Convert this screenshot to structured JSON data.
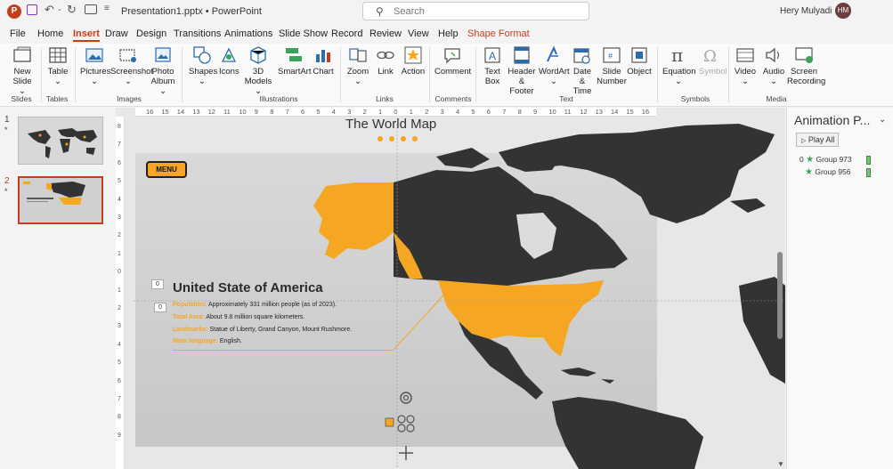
{
  "titlebar": {
    "filename": "Presentation1.pptx  •  PowerPoint",
    "search_placeholder": "Search",
    "user_name": "Hery Mulyadi",
    "avatar_initials": "HM"
  },
  "tabs": [
    "File",
    "Home",
    "Insert",
    "Draw",
    "Design",
    "Transitions",
    "Animations",
    "Slide Show",
    "Record",
    "Review",
    "View",
    "Help",
    "Shape Format"
  ],
  "active_tab": "Insert",
  "ribbon": {
    "buttons": [
      {
        "label": "New\nSlide ⌄",
        "icon": "new-slide-icon"
      },
      {
        "label": "Table\n⌄",
        "icon": "table-icon"
      },
      {
        "label": "Pictures\n⌄",
        "icon": "pictures-icon"
      },
      {
        "label": "Screenshot\n⌄",
        "icon": "screenshot-icon"
      },
      {
        "label": "Photo\nAlbum ⌄",
        "icon": "photo-album-icon"
      },
      {
        "label": "Shapes\n⌄",
        "icon": "shapes-icon"
      },
      {
        "label": "Icons",
        "icon": "icons-icon"
      },
      {
        "label": "3D\nModels ⌄",
        "icon": "3d-models-icon"
      },
      {
        "label": "SmartArt",
        "icon": "smartart-icon"
      },
      {
        "label": "Chart",
        "icon": "chart-icon"
      },
      {
        "label": "Zoom\n⌄",
        "icon": "zoom-icon"
      },
      {
        "label": "Link",
        "icon": "link-icon"
      },
      {
        "label": "Action",
        "icon": "action-icon"
      },
      {
        "label": "Comment",
        "icon": "comment-icon"
      },
      {
        "label": "Text\nBox",
        "icon": "text-box-icon"
      },
      {
        "label": "Header\n& Footer",
        "icon": "header-footer-icon"
      },
      {
        "label": "WordArt\n⌄",
        "icon": "wordart-icon"
      },
      {
        "label": "Date &\nTime",
        "icon": "date-time-icon"
      },
      {
        "label": "Slide\nNumber",
        "icon": "slide-number-icon"
      },
      {
        "label": "Object",
        "icon": "object-icon"
      },
      {
        "label": "Equation\n⌄",
        "icon": "equation-icon"
      },
      {
        "label": "Symbol",
        "icon": "symbol-icon"
      },
      {
        "label": "Video\n⌄",
        "icon": "video-icon"
      },
      {
        "label": "Audio\n⌄",
        "icon": "audio-icon"
      },
      {
        "label": "Screen\nRecording",
        "icon": "screen-recording-icon"
      }
    ],
    "groups": [
      "Slides",
      "Tables",
      "Images",
      "Illustrations",
      "Links",
      "Comments",
      "Text",
      "Symbols",
      "Media"
    ]
  },
  "thumbnails": [
    {
      "number": "1",
      "star": "*"
    },
    {
      "number": "2",
      "star": "*"
    }
  ],
  "ruler_h": [
    "16",
    "15",
    "14",
    "13",
    "12",
    "11",
    "10",
    "9",
    "8",
    "7",
    "6",
    "5",
    "4",
    "3",
    "2",
    "1",
    "0",
    "1",
    "2",
    "3",
    "4",
    "5",
    "6",
    "7",
    "8",
    "9",
    "10",
    "11",
    "12",
    "13",
    "14",
    "15",
    "16"
  ],
  "ruler_v": [
    "8",
    "7",
    "6",
    "5",
    "4",
    "3",
    "2",
    "1",
    "0",
    "1",
    "2",
    "3",
    "4",
    "5",
    "6",
    "7",
    "8",
    "9"
  ],
  "slide": {
    "title": "The World Map",
    "menu_label": "MENU",
    "country": "United State of America",
    "zero_a": "0",
    "zero_b": "0",
    "facts": [
      {
        "label": "Population:",
        "value": " Approximately 331 million people (as of 2023)."
      },
      {
        "label": "Total Area:",
        "value": " About 9.8 million square kilometers."
      },
      {
        "label": "Landmarks:",
        "value": " Statue of Liberty, Grand Canyon, Mount Rushmore."
      },
      {
        "label": "Main language:",
        "value": " English."
      }
    ],
    "colors": {
      "accent": "#f5a623",
      "land": "#333333"
    }
  },
  "animation_pane": {
    "title": "Animation P...",
    "play_all": "Play All",
    "items": [
      {
        "order": "0",
        "name": "Group 973"
      },
      {
        "order": "",
        "name": "Group 956"
      }
    ]
  }
}
